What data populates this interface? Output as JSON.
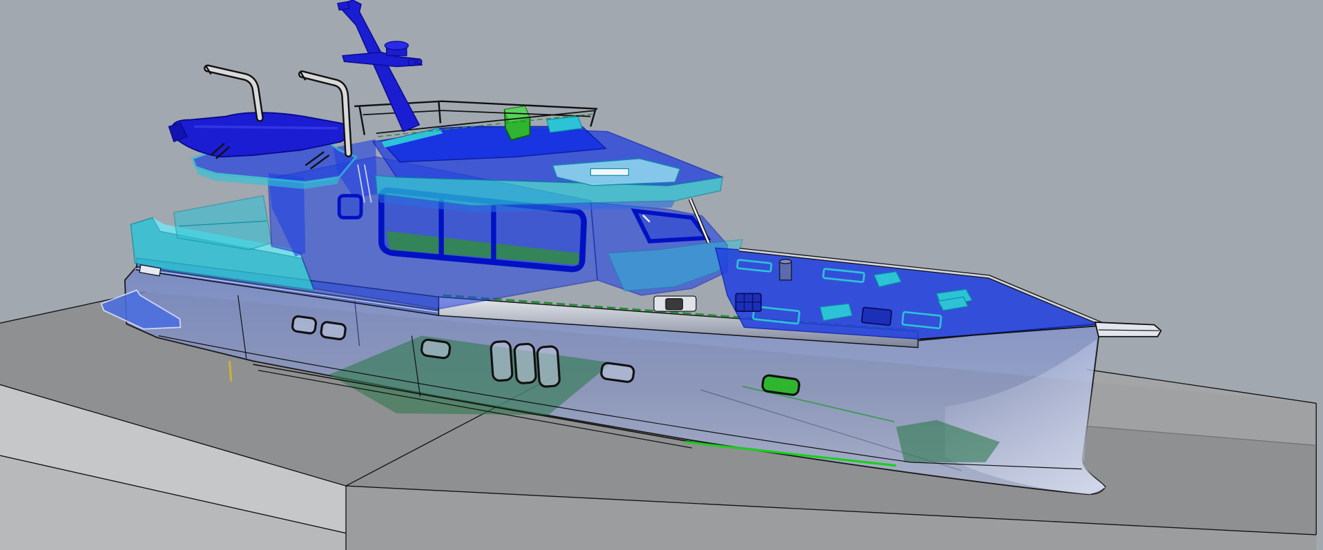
{
  "viewport": {
    "colors": {
      "background": "#a1a8b0",
      "ground_top": "#8f9091",
      "ground_side": "#c6c7c8",
      "ground_front": "#9c9d9e",
      "hull": "#7285c6",
      "superstructure": "#2141e0",
      "tender": "#1b1dd2",
      "cyan_parts": "#2cc3d6",
      "green_parts": "#2fb52f",
      "interior_green": "#2f7a4e",
      "edges": "#111111",
      "davits": "#d9d9d9"
    }
  }
}
